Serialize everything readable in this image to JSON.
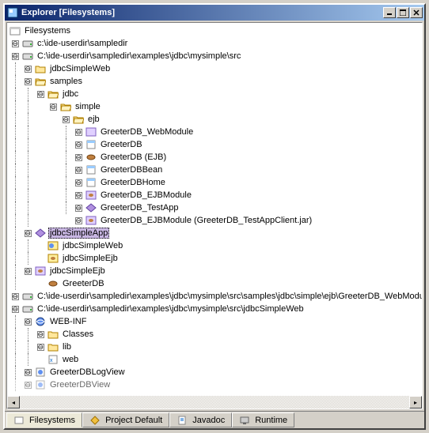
{
  "window": {
    "title": "Explorer [Filesystems]"
  },
  "tree": {
    "root": "Filesystems",
    "nodes": {
      "n1": "c:\\ide-userdir\\sampledir",
      "n2": "C:\\ide-userdir\\sampledir\\examples\\jdbc\\mysimple\\src",
      "n3": "jdbcSimpleWeb",
      "n4": "samples",
      "n5": "jdbc",
      "n6": "simple",
      "n7": "ejb",
      "e1": "GreeterDB_WebModule",
      "e2": "GreeterDB",
      "e3": "GreeterDB (EJB)",
      "e4": "GreeterDBBean",
      "e5": "GreeterDBHome",
      "e6": "GreeterDB_EJBModule",
      "e7": "GreeterDB_TestApp",
      "e8": "GreeterDB_EJBModule (GreeterDB_TestAppClient.jar)",
      "sel": "jdbcSimpleApp",
      "s1": "jdbcSimpleWeb",
      "s2": "jdbcSimpleEjb",
      "s3": "jdbcSimpleEjb",
      "s4": "GreeterDB",
      "n8": "C:\\ide-userdir\\sampledir\\examples\\jdbc\\mysimple\\src\\samples\\jdbc\\simple\\ejb\\GreeterDB_WebModule",
      "n9": "C:\\ide-userdir\\sampledir\\examples\\jdbc\\mysimple\\src\\jdbcSimpleWeb",
      "w1": "WEB-INF",
      "w2": "Classes",
      "w3": "lib",
      "w4": "web",
      "w5": "GreeterDBLogView",
      "w6": "GreeterDBView"
    }
  },
  "tabs": {
    "t1": "Filesystems",
    "t2": "Project Default",
    "t3": "Javadoc",
    "t4": "Runtime"
  }
}
